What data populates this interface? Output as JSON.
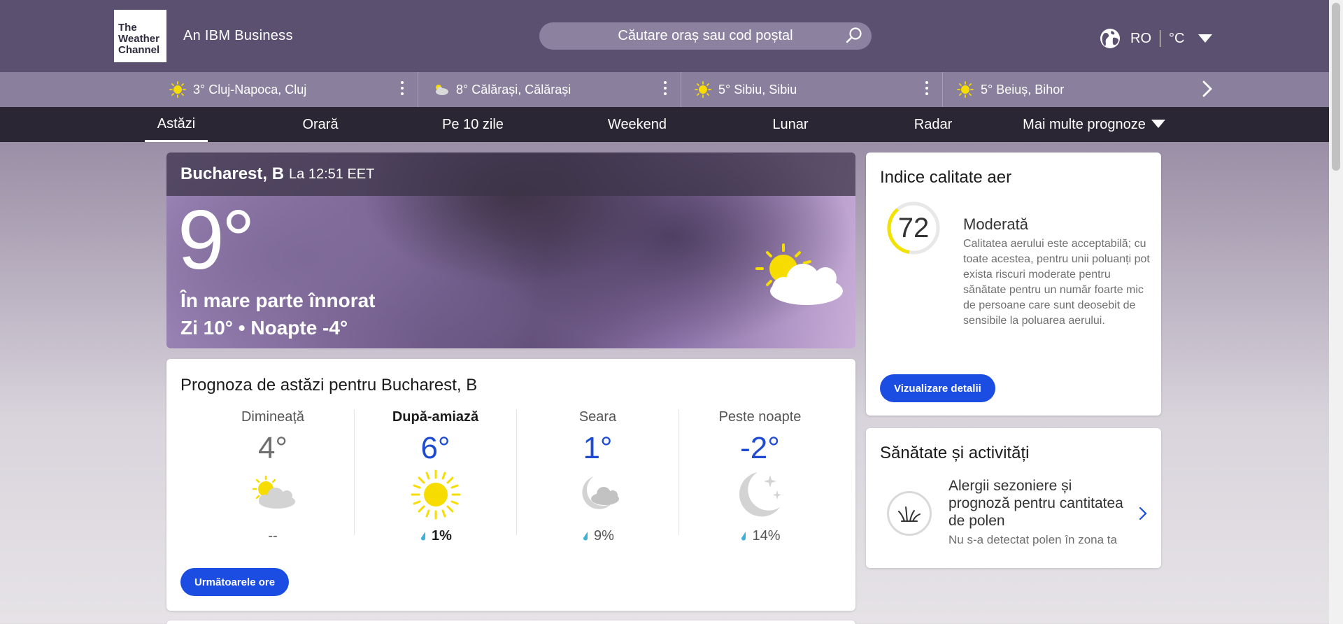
{
  "header": {
    "logo_text": "The Weather Channel",
    "brand_tagline": "An IBM Business",
    "search": {
      "placeholder": "Căutare oraș sau cod poștal"
    },
    "locale": {
      "language": "RO",
      "unit": "°C"
    }
  },
  "recent_locations": [
    {
      "temp": "3°",
      "name": "Cluj-Napoca, Cluj",
      "icon": "sun-icon"
    },
    {
      "temp": "8°",
      "name": "Călărași, Călărași",
      "icon": "cloud-sun-icon"
    },
    {
      "temp": "5°",
      "name": "Sibiu, Sibiu",
      "icon": "sun-icon"
    },
    {
      "temp": "5°",
      "name": "Beiuș, Bihor",
      "icon": "sun-icon"
    }
  ],
  "nav": {
    "items": [
      "Astăzi",
      "Orară",
      "Pe 10 zile",
      "Weekend",
      "Lunar",
      "Radar",
      "Mai multe prognoze"
    ],
    "active": "Astăzi"
  },
  "current": {
    "location": "Bucharest, B",
    "time": "La 12:51 EET",
    "temperature": "9°",
    "phrase": "În mare parte înnorat",
    "hilo": "Zi 10° • Noapte -4°",
    "icon": "partly-cloudy-icon"
  },
  "today_forecast": {
    "title": "Prognoza de astăzi pentru Bucharest, B",
    "periods": [
      {
        "label": "Dimineață",
        "temp": "4°",
        "precip": "--",
        "icon": "partly-cloudy-icon"
      },
      {
        "label": "După-amiază",
        "temp": "6°",
        "precip": "1%",
        "icon": "sun-icon"
      },
      {
        "label": "Seara",
        "temp": "1°",
        "precip": "9%",
        "icon": "cloudy-night-icon"
      },
      {
        "label": "Peste noapte",
        "temp": "-2°",
        "precip": "14%",
        "icon": "clear-night-icon"
      }
    ],
    "button": "Următoarele ore"
  },
  "air_quality": {
    "title": "Indice calitate aer",
    "value": "72",
    "value_fraction": 0.36,
    "category": "Moderată",
    "description": "Calitatea aerului este acceptabilă; cu toate acestea, pentru unii poluanți pot exista riscuri moderate pentru sănătate pentru un număr foarte mic de persoane care sunt deosebit de sensibile la poluarea aerului.",
    "button": "Vizualizare detalii",
    "ring_color": "#f2e200"
  },
  "health": {
    "title": "Sănătate și activități",
    "item_title": "Alergii sezoniere și prognoză pentru cantitatea de polen",
    "item_sub": "Nu s-a detectat polen în zona ta"
  },
  "colors": {
    "header": "#5b5070",
    "recent_strip": "#8a7f9c",
    "nav": "#2a2634",
    "accent_blue": "#1b4de3"
  }
}
